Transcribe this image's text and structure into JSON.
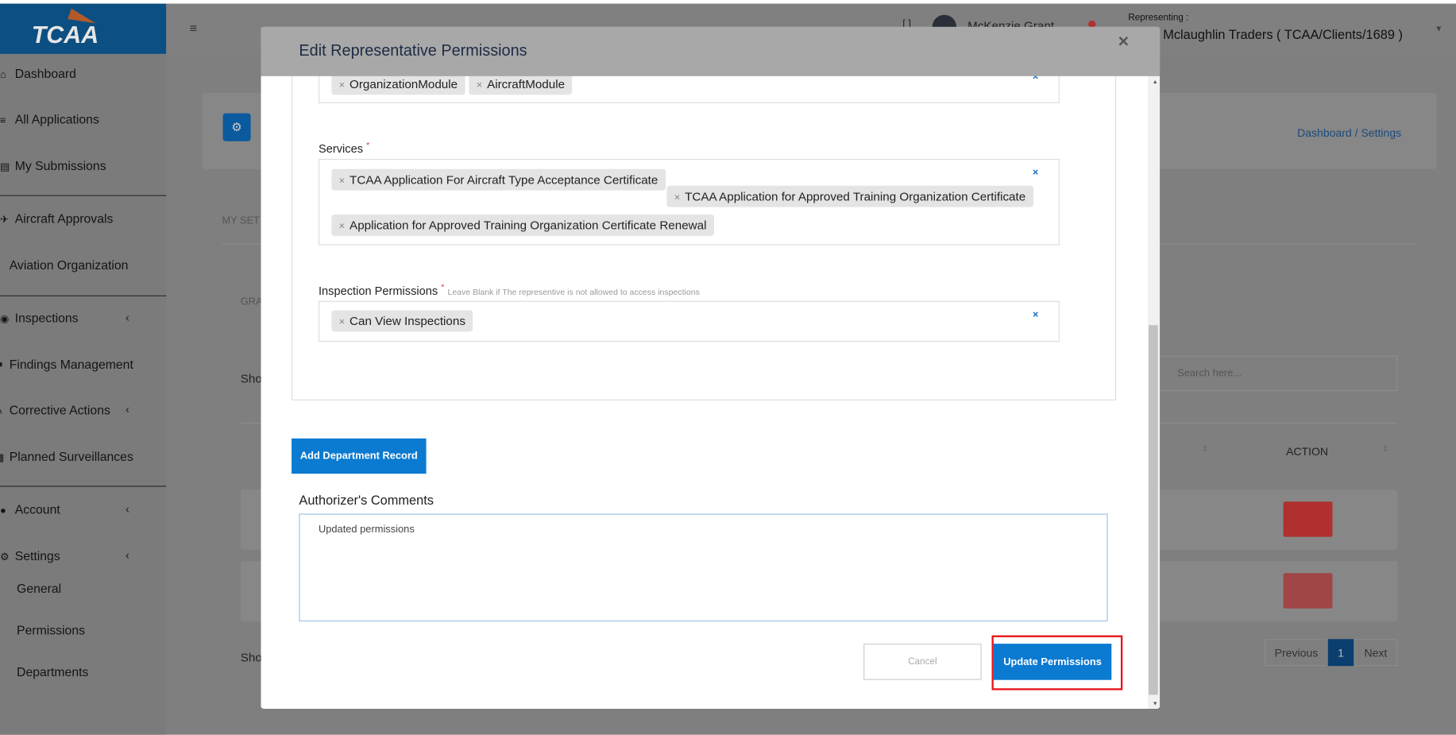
{
  "app": {
    "logo": "TCAA",
    "brand_color": "#0c4f82",
    "accent_color": "#0b7ad1"
  },
  "sidebar": {
    "items": [
      {
        "label": "Dashboard",
        "icon": "home-icon"
      },
      {
        "label": "All Applications",
        "icon": "list-icon"
      },
      {
        "label": "My Submissions",
        "icon": "file-icon"
      },
      {
        "label": "Aircraft Approvals",
        "icon": "plane-icon"
      },
      {
        "label": "Aviation Organization",
        "icon": "user-icon"
      },
      {
        "label": "Inspections",
        "icon": "search-icon"
      },
      {
        "label": "Findings Management",
        "icon": "flag-icon"
      },
      {
        "label": "Corrective Actions",
        "icon": "wrench-icon"
      },
      {
        "label": "Planned Surveillances",
        "icon": "calendar-icon"
      },
      {
        "label": "Account",
        "icon": "user-icon"
      },
      {
        "label": "Settings",
        "icon": "gear-icon"
      },
      {
        "label": "General"
      },
      {
        "label": "Permissions"
      },
      {
        "label": "Departments"
      }
    ]
  },
  "header": {
    "menu_icon": "≡",
    "user_name": "McKenzie Grant",
    "representing_label": "Representing :",
    "representing_value": "r Mclaughlin Traders ( TCAA/Clients/1689 )"
  },
  "background": {
    "breadcrumb": [
      "Dashboard",
      "Settings"
    ],
    "tab_partial": "MY SET",
    "section_partial": "GRA",
    "show_partial": "Sho",
    "search_placeholder": "Search here...",
    "action_header": "ACTION",
    "pagination": {
      "previous": "Previous",
      "page": "1",
      "next": "Next"
    }
  },
  "modal": {
    "title": "Edit Representative Permissions",
    "close": "×",
    "modules": [
      "OrganizationModule",
      "AircraftModule"
    ],
    "services_label": "Services",
    "services": [
      "TCAA Application For Aircraft Type Acceptance Certificate",
      "TCAA Application for Approved Training Organization Certificate",
      "Application for Approved Training Organization Certificate Renewal"
    ],
    "inspection_label": "Inspection Permissions",
    "inspection_hint": "Leave Blank if The representive is not allowed to access inspections",
    "inspections": [
      "Can View Inspections"
    ],
    "required_mark": "*",
    "add_department": "Add Department Record",
    "comments_label": "Authorizer's Comments",
    "comments_value": "Updated permissions",
    "cancel": "Cancel",
    "update": "Update Permissions"
  }
}
